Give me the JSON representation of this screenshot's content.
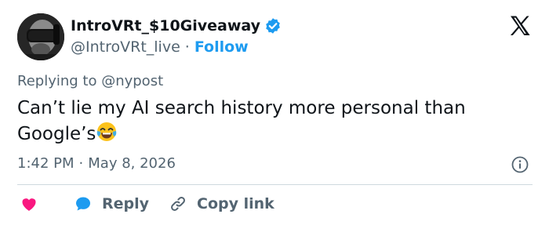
{
  "author": {
    "display_name": "IntroVRt_$10Giveaway",
    "handle": "@IntroVRt_live",
    "separator": "·",
    "follow_label": "Follow"
  },
  "reply_context": "Replying to @nypost",
  "tweet": {
    "text": "Can’t lie my AI search history more personal than Google’s",
    "emoji": "face-with-tears-of-joy"
  },
  "meta": {
    "time": "1:42 PM",
    "separator": "·",
    "date": "May 8, 2026"
  },
  "actions": {
    "reply_label": "Reply",
    "copy_link_label": "Copy link"
  },
  "icons": {
    "verified": "verified-badge-icon",
    "logo": "x-logo-icon",
    "info": "info-icon",
    "like": "heart-icon",
    "reply": "speech-bubble-icon",
    "copy": "link-icon"
  },
  "colors": {
    "text_primary": "#0f1419",
    "text_secondary": "#536471",
    "accent_blue": "#1d9bf0",
    "like_pink": "#f91880",
    "divider": "#cfd9de"
  }
}
